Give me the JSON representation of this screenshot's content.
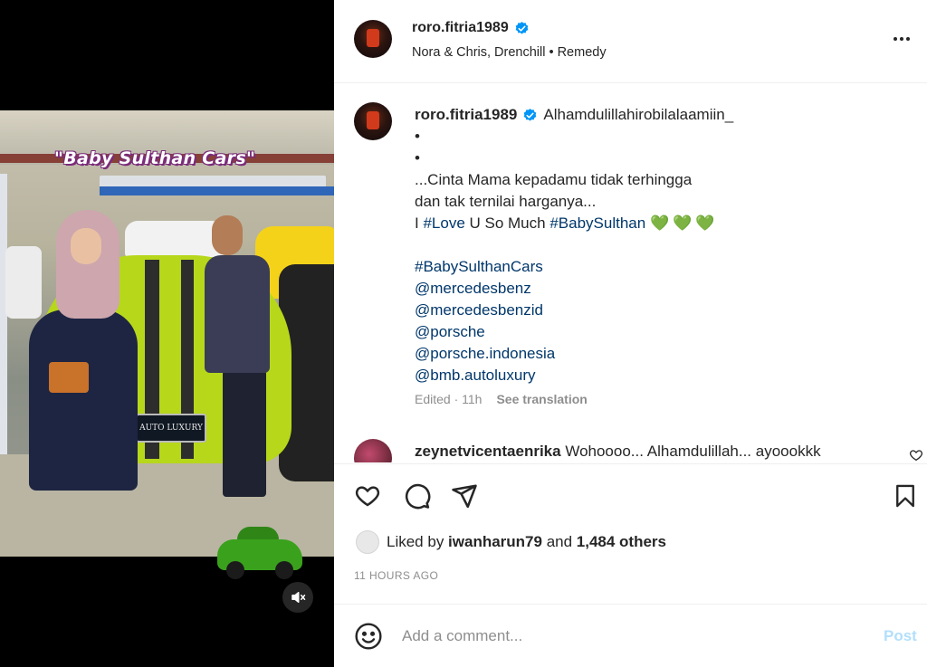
{
  "post": {
    "username": "roro.fitria1989",
    "verified": true,
    "audio": "Nora & Chris, Drenchill • Remedy",
    "media": {
      "overlay_caption": "\"Baby Sulthan Cars\"",
      "plate_text": "AUTO LUXURY",
      "muted": true
    },
    "caption": {
      "username": "roro.fitria1989",
      "first_line": "Alhamdulillahirobilalaamiin_",
      "bullet1": "•",
      "bullet2": "•",
      "line3": "...Cinta Mama kepadamu tidak terhingga",
      "line4": "dan tak ternilai harganya...",
      "line5_prefix": "I ",
      "line5_tag1": "#Love",
      "line5_mid": " U So Much ",
      "line5_tag2": "#BabySulthan",
      "line5_hearts": "💚💚💚",
      "tags": [
        "#BabySulthanCars",
        "@mercedesbenz",
        "@mercedesbenzid",
        "@porsche",
        "@porsche.indonesia",
        "@bmb.autoluxury"
      ]
    },
    "caption_meta": {
      "edited": "Edited · 11h",
      "translate": "See translation"
    },
    "comment": {
      "username": "zeynetvicentaenrika",
      "text": "Wohoooo... Alhamdulillah... ayoookkk"
    },
    "likes": {
      "prefix": "Liked by ",
      "user": "iwanharun79",
      "middle": " and ",
      "others": "1,484 others"
    },
    "timestamp": "11 HOURS AGO",
    "add_comment": {
      "placeholder": "Add a comment...",
      "post_label": "Post"
    }
  },
  "icons": [
    "more-icon",
    "verified-icon",
    "heart-icon",
    "comment-icon",
    "share-icon",
    "bookmark-icon",
    "emoji-icon",
    "mute-icon"
  ],
  "colors": {
    "link": "#00376b",
    "verified": "#0095f6",
    "post_disabled": "#b2dffc",
    "muted_text": "#8e8e8e",
    "hearts": "#1fcf5c"
  }
}
